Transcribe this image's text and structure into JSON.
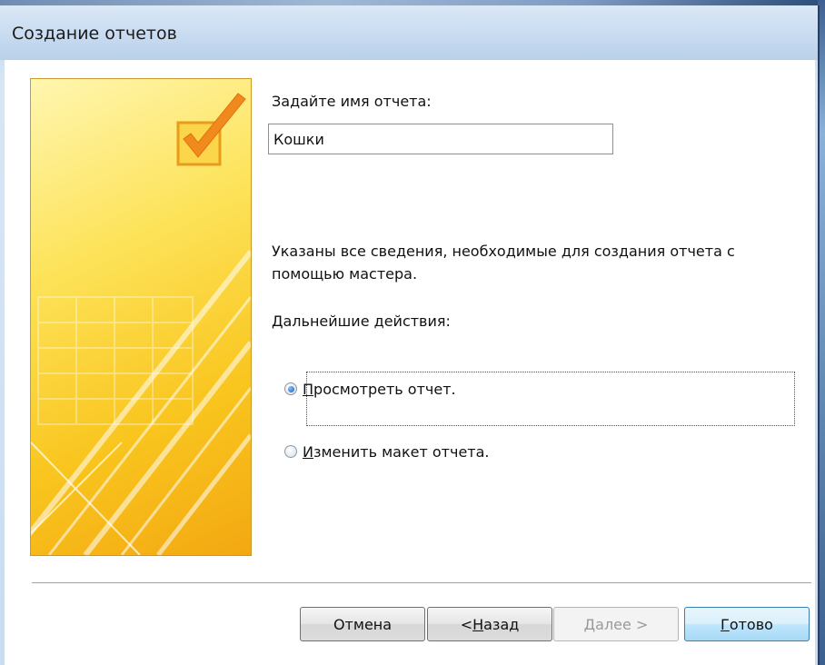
{
  "window": {
    "title": "Создание отчетов"
  },
  "form": {
    "name_label": "Задайте имя отчета:",
    "name_value": "Кошки",
    "info_text": "Указаны все сведения, необходимые для создания отчета с помощью мастера.",
    "next_label": "Дальнейшие действия:"
  },
  "options": [
    {
      "prefix": "",
      "accel": "П",
      "rest": "росмотреть отчет.",
      "selected": true
    },
    {
      "prefix": "",
      "accel": "И",
      "rest": "зменить макет отчета.",
      "selected": false
    }
  ],
  "buttons": {
    "cancel": {
      "label": "Отмена",
      "enabled": true
    },
    "back": {
      "prefix": "< ",
      "accel": "Н",
      "rest": "азад",
      "enabled": true
    },
    "next": {
      "prefix": "",
      "accel": "Д",
      "rest": "алее >",
      "enabled": false
    },
    "finish": {
      "prefix": "",
      "accel": "Г",
      "rest": "отово",
      "enabled": true
    }
  },
  "colors": {
    "panel_yellow": "#fde35a",
    "panel_orange": "#f3a812",
    "accent_blue": "#3c7fb1"
  },
  "icons": {
    "wizard_image": "checkbox-checkmark-icon",
    "radio": "radio-icon"
  }
}
